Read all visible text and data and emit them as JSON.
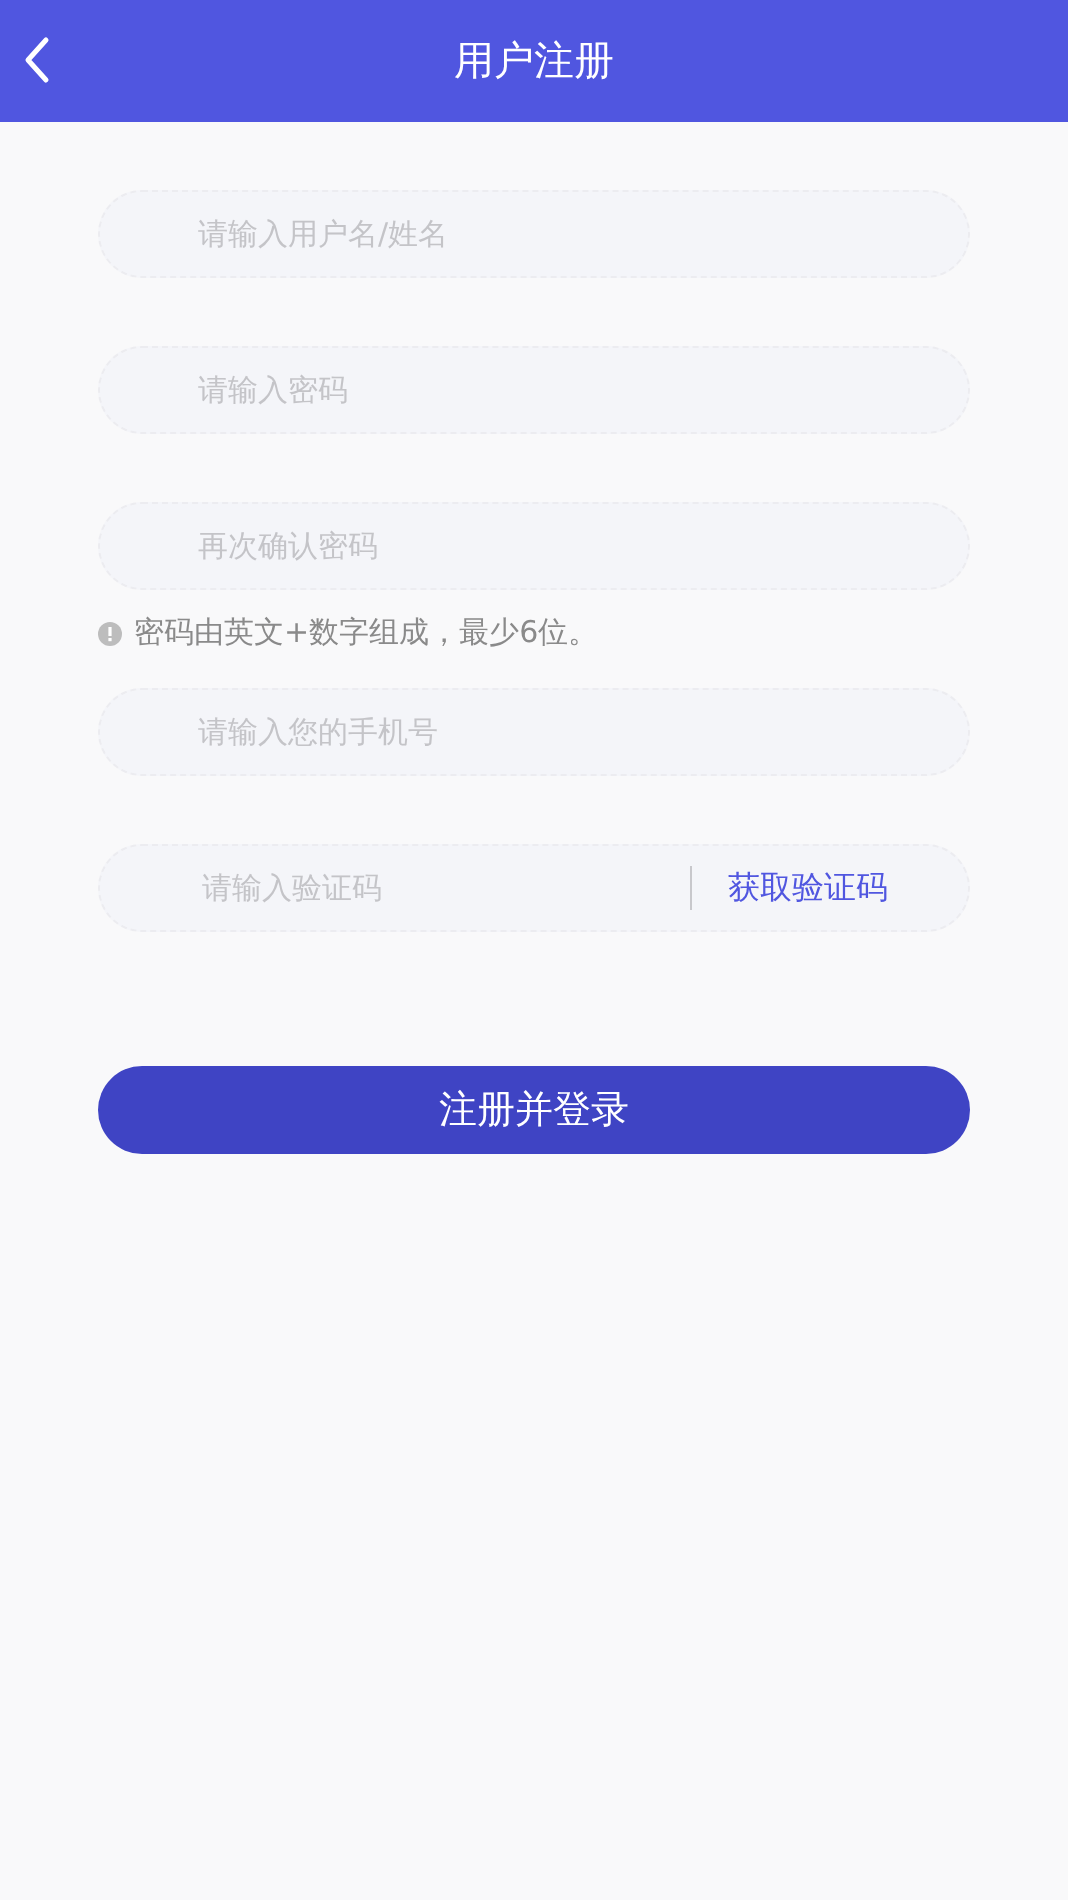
{
  "header": {
    "title": "用户注册"
  },
  "form": [
    {
      "kind": "field",
      "placeholder": "请输入用户名/姓名"
    },
    {
      "kind": "field",
      "placeholder": "请输入密码"
    },
    {
      "kind": "field",
      "placeholder": "再次确认密码"
    },
    {
      "kind": "hint",
      "text": "密码由英文+数字组成，最少6位。"
    },
    {
      "kind": "field",
      "placeholder": "请输入您的手机号"
    },
    {
      "kind": "code",
      "placeholder": "请输入验证码",
      "action": "获取验证码"
    }
  ],
  "submit": "注册并登录"
}
